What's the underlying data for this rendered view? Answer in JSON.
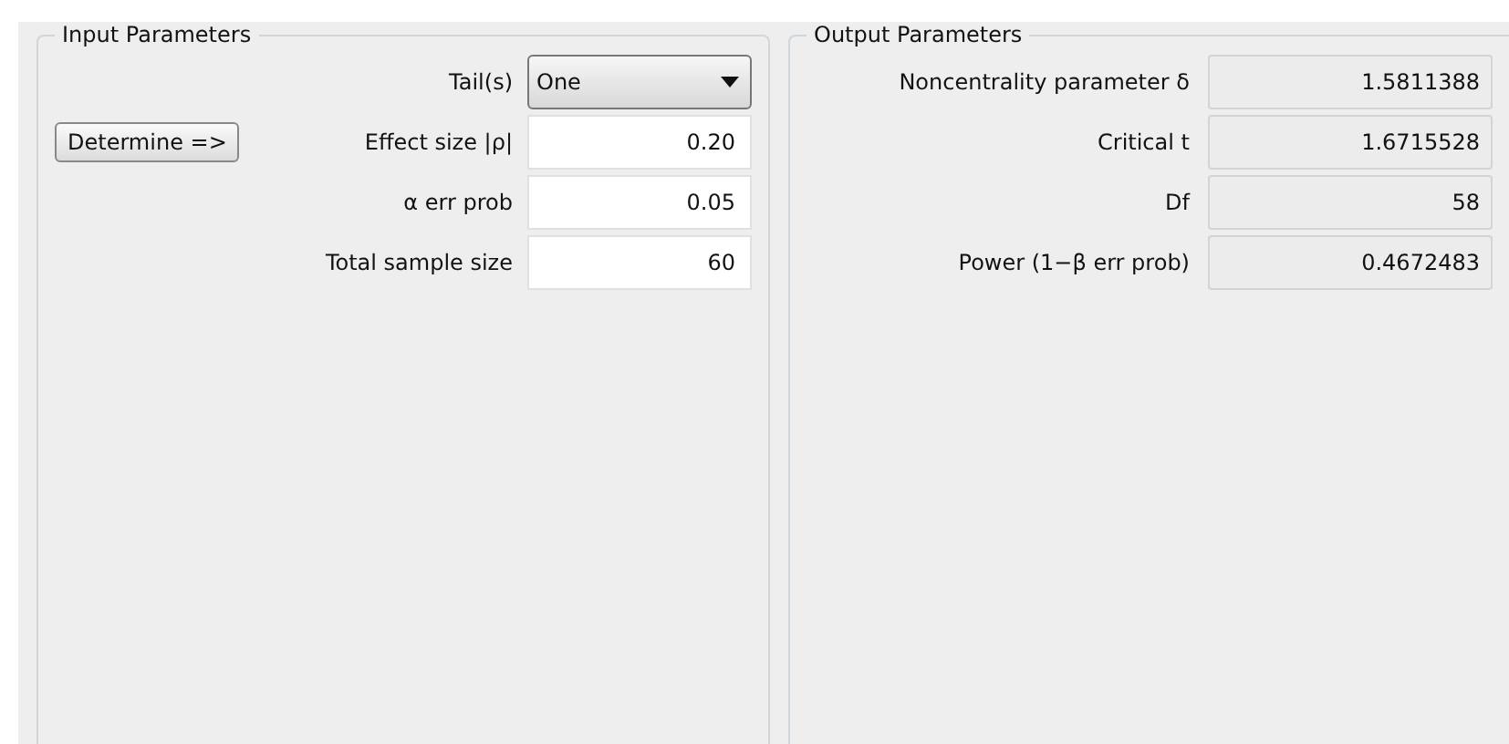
{
  "input_parameters": {
    "title": "Input Parameters",
    "determine_button": "Determine =>",
    "fields": [
      {
        "kind": "dropdown",
        "label": "Tail(s)",
        "value": "One"
      },
      {
        "kind": "text",
        "label": "Effect size |ρ|",
        "value": "0.20"
      },
      {
        "kind": "text",
        "label": "α err prob",
        "value": "0.05"
      },
      {
        "kind": "text",
        "label": "Total sample size",
        "value": "60"
      }
    ]
  },
  "output_parameters": {
    "title": "Output Parameters",
    "fields": [
      {
        "label": "Noncentrality parameter δ",
        "value": "1.5811388"
      },
      {
        "label": "Critical t",
        "value": "1.6715528"
      },
      {
        "label": "Df",
        "value": "58"
      },
      {
        "label": "Power (1−β err prob)",
        "value": "0.4672483"
      }
    ]
  }
}
